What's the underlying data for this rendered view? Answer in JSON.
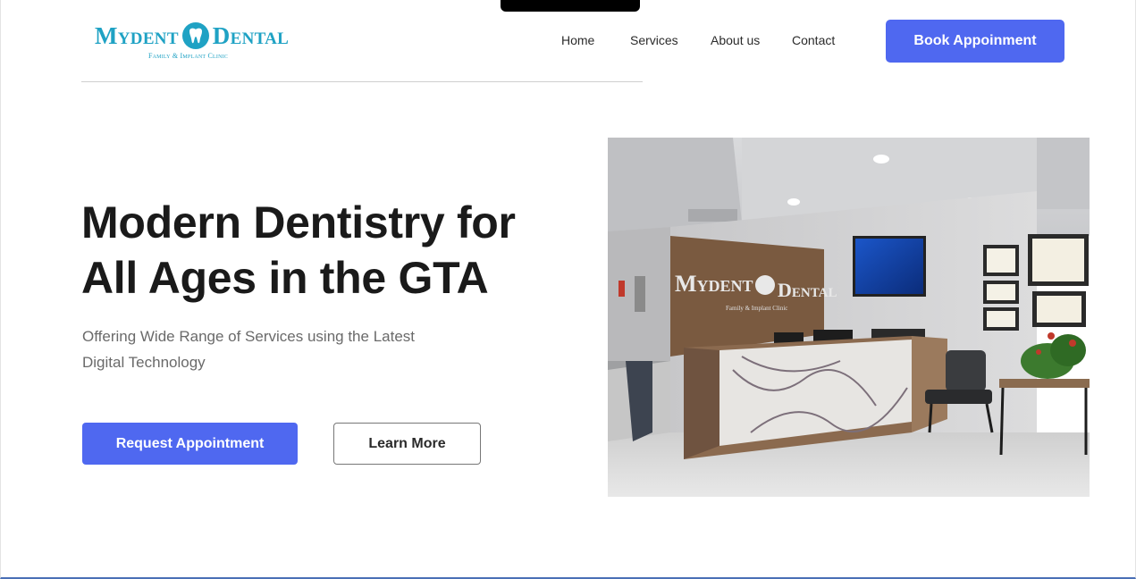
{
  "logo": {
    "word_left": "Mydent",
    "word_right": "Dental",
    "tagline": "Family & Implant Clinic"
  },
  "nav": {
    "items": [
      "Home",
      "Services",
      "About us",
      "Contact"
    ]
  },
  "header": {
    "book_label": "Book Appoinment"
  },
  "hero": {
    "title_line1": "Modern Dentistry for",
    "title_line2": "All Ages in the GTA",
    "subtitle_line1": "Offering Wide Range of Services using the Latest",
    "subtitle_line2": "Digital Technology",
    "primary_button": "Request Appointment",
    "secondary_button": "Learn More"
  },
  "photo": {
    "sign_left": "Mydent",
    "sign_right": "Dental",
    "sign_tagline": "Family & Implant Clinic"
  },
  "colors": {
    "brand": "#1fa2c4",
    "accent": "#4f68f0"
  }
}
